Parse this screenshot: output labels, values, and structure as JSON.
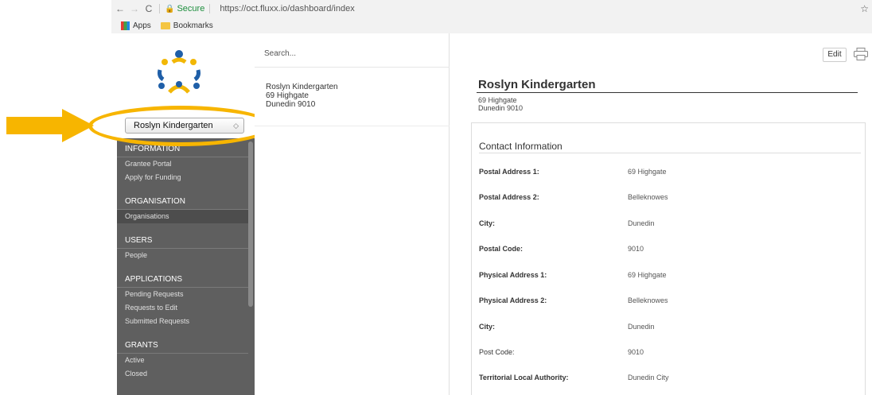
{
  "browser": {
    "secure_label": "Secure",
    "url": "https://oct.fluxx.io/dashboard/index",
    "bookmarks": [
      {
        "label": "Apps",
        "icon": "apps-grid-icon"
      },
      {
        "label": "Bookmarks",
        "icon": "folder-icon"
      }
    ]
  },
  "sidebar": {
    "org_selected": "Roslyn Kindergarten",
    "sections": [
      {
        "title": "INFORMATION",
        "items": [
          "Grantee Portal",
          "Apply for Funding"
        ]
      },
      {
        "title": "ORGANISATION",
        "items": [
          "Organisations"
        ]
      },
      {
        "title": "USERS",
        "items": [
          "People"
        ]
      },
      {
        "title": "APPLICATIONS",
        "items": [
          "Pending Requests",
          "Requests to Edit",
          "Submitted Requests"
        ]
      },
      {
        "title": "GRANTS",
        "items": [
          "Active",
          "Closed"
        ]
      }
    ]
  },
  "list": {
    "search_placeholder": "Search...",
    "item": {
      "name": "Roslyn Kindergarten",
      "line1": "69 Highgate",
      "line2": "Dunedin 9010"
    }
  },
  "detail": {
    "edit_label": "Edit",
    "title": "Roslyn Kindergarten",
    "addr1": "69 Highgate",
    "addr2": "Dunedin 9010",
    "card_title": "Contact Information",
    "fields": [
      {
        "label": "Postal Address 1:",
        "value": "69 Highgate"
      },
      {
        "label": "Postal Address 2:",
        "value": "Belleknowes"
      },
      {
        "label": "City:",
        "value": "Dunedin"
      },
      {
        "label": "Postal Code:",
        "value": "9010"
      },
      {
        "label": "Physical Address 1:",
        "value": "69 Highgate"
      },
      {
        "label": "Physical Address 2:",
        "value": "Belleknowes"
      },
      {
        "label": "City:",
        "value": "Dunedin"
      },
      {
        "label": "Post Code:",
        "value": "9010"
      },
      {
        "label": "Territorial Local Authority:",
        "value": "Dunedin City"
      }
    ]
  },
  "colors": {
    "accent": "#f7b500",
    "sidebar": "#5f5f5f"
  }
}
